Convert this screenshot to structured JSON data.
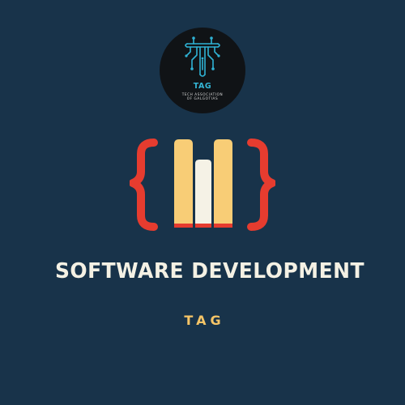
{
  "logo": {
    "name": "TAG",
    "subtitle_line1": "TECH ASSOCIATION",
    "subtitle_line2": "OF GALGOTIAS",
    "accent_color": "#34b6d6",
    "icon": "circuit-t-icon"
  },
  "emblem": {
    "icon": "code-braces-books-icon",
    "brace_color": "#e63c2f",
    "book_color": "#f8cd76",
    "center_book_color": "#f5f2e6"
  },
  "title": "SOFTWARE DEVELOPMENT",
  "tagline": "TAG",
  "colors": {
    "background": "#18334a",
    "title": "#f4f1e4",
    "tagline": "#f6c567"
  }
}
